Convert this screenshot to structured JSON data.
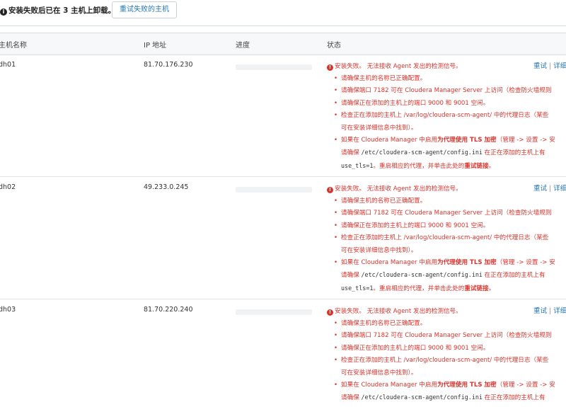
{
  "banner": {
    "message": "安装失败后已在 3 主机上卸载。",
    "retry_failed_button": "重试失败的主机"
  },
  "table": {
    "columns": [
      "主机名称",
      "IP 地址",
      "进度",
      "状态"
    ],
    "rows": [
      {
        "hostname": "dh01",
        "ip": "81.70.176.230",
        "status_title": "安装失败。 无法接收 Agent 发出的检测信号。",
        "reason_1": "请确保主机的名称已正确配置。",
        "reason_2": "请确保端口 7182 可在 Cloudera Manager Server 上访问（检查防火墙规则",
        "reason_3": "请确保正在添加的主机上的端口 9000 和 9001 空闲。",
        "reason_4_a": "检查正在添加的主机上 /var/log/cloudera-scm-agent/ 中的代理日志（某些",
        "reason_4_b": "可在安装详细信息中找到）。",
        "reason_5_a1": "如果在 Cloudera Manager 中启用",
        "reason_5_a2": "为代理使用 TLS 加密",
        "reason_5_a3": "（管理 -> 设置 -> 安",
        "reason_5_b1": "请确保 ",
        "reason_5_b2": "/etc/cloudera-scm-agent/config.ini",
        "reason_5_b3": " 在正在添加的主机上有",
        "reason_5_c1": "use_tls=1",
        "reason_5_c2": "。重启相应的代理，并单击此处的",
        "reason_5_c3": "重试链接",
        "reason_5_c4": "。",
        "action_retry": "重试",
        "action_sep": "|",
        "action_details": "详细"
      },
      {
        "hostname": "dh02",
        "ip": "49.233.0.245",
        "status_title": "安装失败。 无法接收 Agent 发出的检测信号。",
        "reason_1": "请确保主机的名称已正确配置。",
        "reason_2": "请确保端口 7182 可在 Cloudera Manager Server 上访问（检查防火墙规则",
        "reason_3": "请确保正在添加的主机上的端口 9000 和 9001 空闲。",
        "reason_4_a": "检查正在添加的主机上 /var/log/cloudera-scm-agent/ 中的代理日志（某些",
        "reason_4_b": "可在安装详细信息中找到）。",
        "reason_5_a1": "如果在 Cloudera Manager 中启用",
        "reason_5_a2": "为代理使用 TLS 加密",
        "reason_5_a3": "（管理 -> 设置 -> 安",
        "reason_5_b1": "请确保 ",
        "reason_5_b2": "/etc/cloudera-scm-agent/config.ini",
        "reason_5_b3": " 在正在添加的主机上有",
        "reason_5_c1": "use_tls=1",
        "reason_5_c2": "。重启相应的代理，并单击此处的",
        "reason_5_c3": "重试链接",
        "reason_5_c4": "。",
        "action_retry": "重试",
        "action_sep": "|",
        "action_details": "详细"
      },
      {
        "hostname": "dh03",
        "ip": "81.70.220.240",
        "status_title": "安装失败。 无法接收 Agent 发出的检测信号。",
        "reason_1": "请确保主机的名称已正确配置。",
        "reason_2": "请确保端口 7182 可在 Cloudera Manager Server 上访问（检查防火墙规则",
        "reason_3": "请确保正在添加的主机上的端口 9000 和 9001 空闲。",
        "reason_4_a": "检查正在添加的主机上 /var/log/cloudera-scm-agent/ 中的代理日志（某些",
        "reason_4_b": "可在安装详细信息中找到）。",
        "reason_5_a1": "如果在 Cloudera Manager 中启用",
        "reason_5_a2": "为代理使用 TLS 加密",
        "reason_5_a3": "（管理 -> 设置 -> 安",
        "reason_5_b1": "请确保 ",
        "reason_5_b2": "/etc/cloudera-scm-agent/config.ini",
        "reason_5_b3": " 在正在添加的主机上有",
        "action_retry": "重试",
        "action_sep": "|",
        "action_details": "详细"
      }
    ]
  },
  "colors": {
    "error": "#d9332c",
    "link": "#2477b3",
    "header_bg": "#f6f8f9"
  },
  "icons": {
    "banner": "info-circle-icon",
    "status": "error-circle-icon"
  }
}
